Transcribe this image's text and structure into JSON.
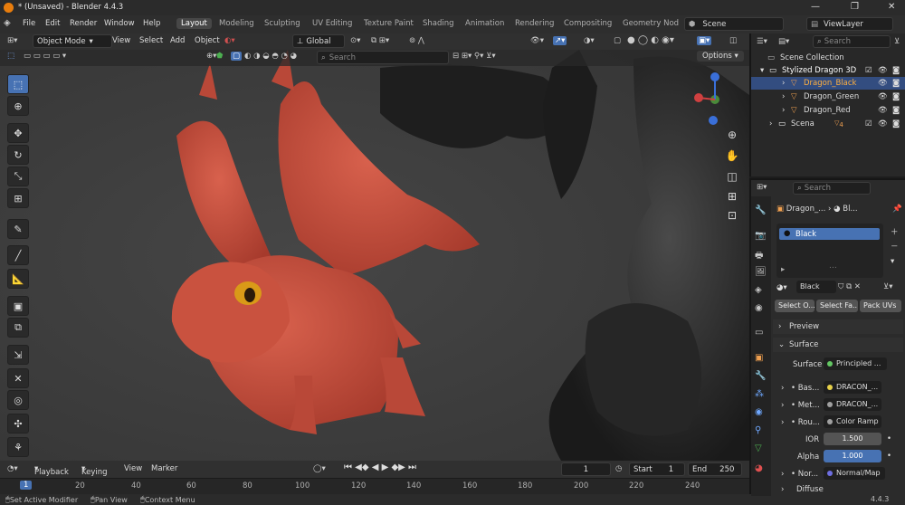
{
  "window": {
    "title": "* (Unsaved) - Blender 4.4.3",
    "min": "—",
    "max": "❐",
    "close": "✕"
  },
  "menu": {
    "items": [
      "File",
      "Edit",
      "Render",
      "Window",
      "Help"
    ],
    "workspaces": [
      "Layout",
      "Modeling",
      "Sculpting",
      "UV Editing",
      "Texture Paint",
      "Shading",
      "Animation",
      "Rendering",
      "Compositing",
      "Geometry Node"
    ],
    "scene": "Scene",
    "view_layer": "ViewLayer"
  },
  "viewport_header": {
    "mode": "Object Mode",
    "view": "View",
    "select": "Select",
    "add": "Add",
    "object": "Object",
    "orientation": "Global",
    "search_placeholder": "Search",
    "options": "Options"
  },
  "outliner": {
    "search_placeholder": "Search",
    "root": "Scene Collection",
    "collection": "Stylized Dragon 3D",
    "objects": [
      "Dragon_Black",
      "Dragon_Green",
      "Dragon_Red"
    ],
    "scena": "Scena",
    "badge": "4"
  },
  "properties": {
    "search_placeholder": "Search",
    "breadcrumb_obj": "Dragon_...",
    "breadcrumb_mat": "Bl...",
    "slot": "Black",
    "material_name": "Black",
    "btn_select_o": "Select O...",
    "btn_select_fa": "Select Fa...",
    "btn_pack_uvs": "Pack UVs",
    "preview": "Preview",
    "surface_section": "Surface",
    "surface_label": "Surface",
    "surface_value": "Principled ...",
    "rows": [
      {
        "label": "Bas...",
        "value": "DRACON_..."
      },
      {
        "label": "Met...",
        "value": "DRACON_..."
      },
      {
        "label": "Rou...",
        "value": "Color Ramp"
      }
    ],
    "ior_label": "IOR",
    "ior_value": "1.500",
    "alpha_label": "Alpha",
    "alpha_value": "1.000",
    "normal_label": "Nor...",
    "normal_value": "Normal/Map",
    "diffuse": "Diffuse"
  },
  "timeline": {
    "playback": "Playback",
    "keying": "Keying",
    "view": "View",
    "marker": "Marker",
    "current_frame": "1",
    "start_label": "Start",
    "start": "1",
    "end_label": "End",
    "end": "250",
    "ticks": [
      "1",
      "20",
      "40",
      "60",
      "80",
      "100",
      "120",
      "140",
      "160",
      "180",
      "200",
      "220",
      "240"
    ]
  },
  "status": {
    "left": "Set Active Modifier",
    "middle": "Pan View",
    "right": "Context Menu",
    "version": "4.4.3"
  },
  "colors": {
    "accent": "#4772b3",
    "dragon_red": "#c0503f",
    "selection": "#334d80"
  }
}
